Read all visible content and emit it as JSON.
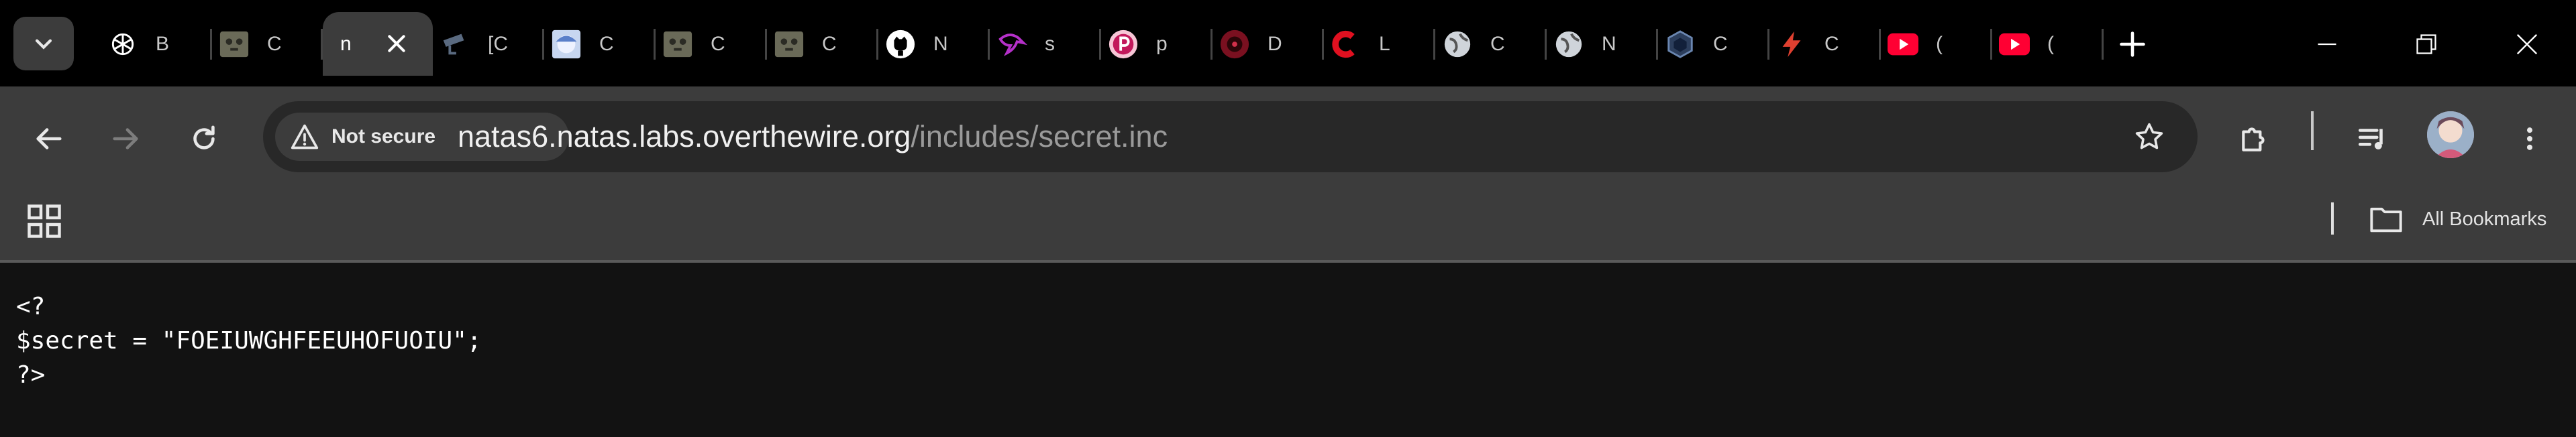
{
  "tabs": [
    {
      "title": "B",
      "icon": "chatgpt-icon"
    },
    {
      "title": "C",
      "icon": "cat-image-icon"
    },
    {
      "title": "n",
      "icon": "none",
      "active": true
    },
    {
      "title": "[C",
      "icon": "camera-icon"
    },
    {
      "title": "C",
      "icon": "anime-avatar-icon"
    },
    {
      "title": "C",
      "icon": "cat-image-icon"
    },
    {
      "title": "C",
      "icon": "cat-image-icon"
    },
    {
      "title": "N",
      "icon": "github-icon"
    },
    {
      "title": "s",
      "icon": "purple-bird-icon"
    },
    {
      "title": "p",
      "icon": "pink-p-icon"
    },
    {
      "title": "D",
      "icon": "dark-red-globe-icon"
    },
    {
      "title": "L",
      "icon": "red-c-icon"
    },
    {
      "title": "C",
      "icon": "globe-icon"
    },
    {
      "title": "N",
      "icon": "globe-icon"
    },
    {
      "title": "C",
      "icon": "hexagon-icon"
    },
    {
      "title": "C",
      "icon": "lightning-icon"
    },
    {
      "title": "(",
      "icon": "youtube-icon"
    },
    {
      "title": "(",
      "icon": "youtube-icon"
    }
  ],
  "security_chip": {
    "label": "Not secure"
  },
  "address": {
    "host": "natas6.natas.labs.overthewire.org",
    "path": "/includes/secret.inc"
  },
  "bookmarks": {
    "all_label": "All Bookmarks"
  },
  "page": {
    "lines": [
      "<?",
      "$secret = \"FOEIUWGHFEEUHOFUOIU\";",
      "?>"
    ]
  },
  "colors": {
    "tabstrip": "#000000",
    "toolbar": "#3c3c3c",
    "omnibox": "#282828",
    "page_bg": "#121212",
    "youtube_red": "#ff0033"
  }
}
